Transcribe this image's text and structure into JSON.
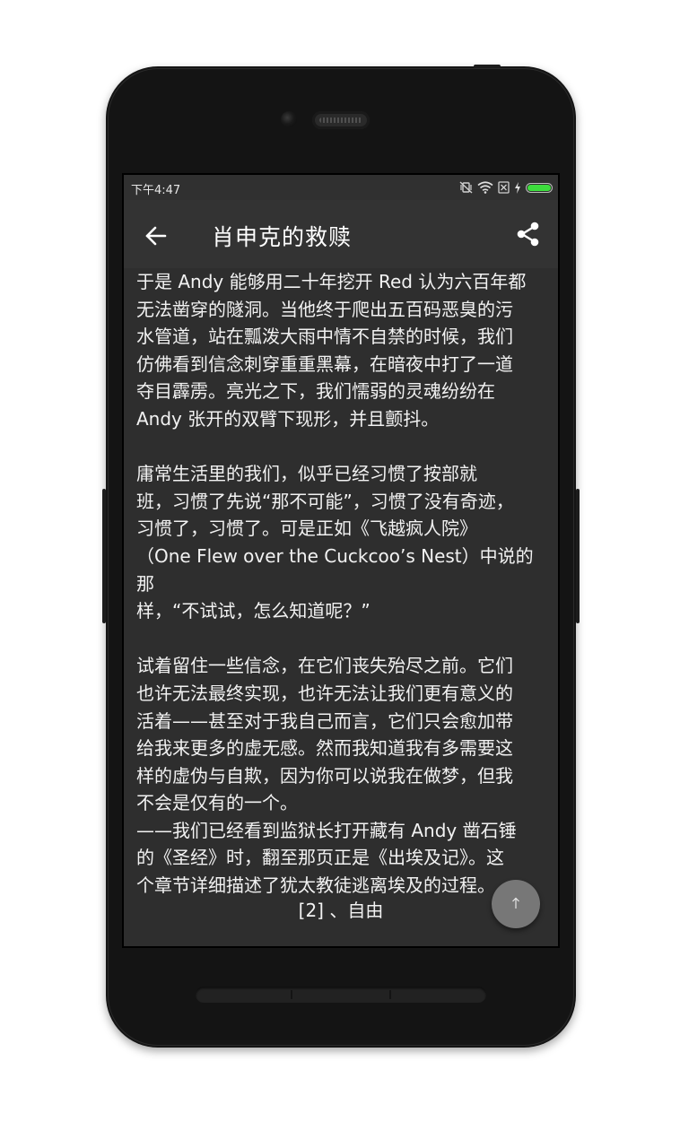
{
  "status_bar": {
    "time": "下午4:47",
    "battery_level": 1.0,
    "battery_color": "#3ddc3d"
  },
  "app_bar": {
    "title": "肖申克的救赎",
    "back_icon": "arrow-left-icon",
    "share_icon": "share-icon"
  },
  "content": {
    "paragraph_1_lines": [
      "于是 Andy 能够用二十年挖开 Red 认为六百年都",
      "无法凿穿的隧洞。当他终于爬出五百码恶臭的污",
      "水管道，站在瓢泼大雨中情不自禁的时候，我们",
      "仿佛看到信念刺穿重重黑幕，在暗夜中打了一道",
      "夺目霹雳。亮光之下，我们懦弱的灵魂纷纷在",
      "Andy 张开的双臂下现形，并且颤抖。"
    ],
    "paragraph_2_lines": [
      "庸常生活里的我们，似乎已经习惯了按部就",
      "班，习惯了先说“那不可能”，习惯了没有奇迹，",
      "习惯了，习惯了。可是正如《飞越疯人院》",
      "（One Flew over the Cuckcoo’s Nest）中说的那",
      "样，“不试试，怎么知道呢？”"
    ],
    "paragraph_3_lines": [
      "试着留住一些信念，在它们丧失殆尽之前。它们",
      "也许无法最终实现，也许无法让我们更有意义的",
      "活着——甚至对于我自己而言，它们只会愈加带",
      "给我来更多的虚无感。然而我知道我有多需要这",
      "样的虚伪与自欺，因为你可以说我在做梦，但我",
      "不会是仅有的一个。",
      "——我们已经看到监狱长打开藏有 Andy 凿石锤",
      "的《圣经》时，翻至那页正是《出埃及记》。这",
      "个章节详细描述了犹太教徒逃离埃及的过程。"
    ],
    "section_heading": "[2] 、自由"
  },
  "fab": {
    "icon": "arrow-up-icon"
  },
  "colors": {
    "screen_background": "#2e2e2e",
    "app_bar": "#333333",
    "text": "#f2f2f2",
    "fab": "#777777"
  }
}
